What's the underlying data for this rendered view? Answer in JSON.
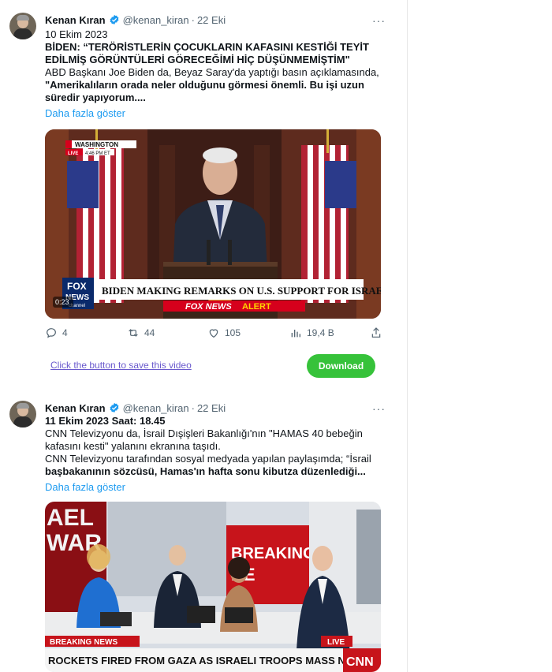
{
  "tweets": [
    {
      "author_name": "Kenan Kıran",
      "handle": "@kenan_kiran",
      "separator": "·",
      "date": "22 Eki",
      "more_label": "···",
      "lines": [
        "10 Ekim 2023",
        "BİDEN: “TERÖRİSTLERİN ÇOCUKLARIN KAFASINI KESTİĞİ TEYİT",
        "EDİLMİŞ GÖRÜNTÜLERİ GÖRECEĞİMİ HİÇ DÜŞÜNMEMİŞTİM\"",
        "ABD Başkanı Joe Biden da, Beyaz Saray'da yaptığı basın açıklamasında,",
        "\"Amerikalıların orada neler olduğunu görmesi önemli. Bu işi uzun",
        "süredir yapıyorum...."
      ],
      "show_more": "Daha fazla göster",
      "video": {
        "location": "WASHINGTON",
        "live": "LIVE",
        "time": "4:46 PM ET",
        "headline": "BIDEN MAKING REMARKS ON U.S. SUPPORT FOR ISRAEL",
        "logo_top": "FOX",
        "logo_bottom": "NEWS",
        "logo_sub": "channel",
        "alert_brand": "FOX NEWS",
        "alert_word": "ALERT",
        "timestamp": "0:23"
      },
      "stats": {
        "replies": "4",
        "retweets": "44",
        "likes": "105",
        "views": "19,4 B"
      }
    },
    {
      "author_name": "Kenan Kıran",
      "handle": "@kenan_kiran",
      "separator": "·",
      "date": "22 Eki",
      "more_label": "···",
      "lines": [
        "11 Ekim 2023 Saat: 18.45",
        "CNN Televizyonu da, İsrail Dışişleri Bakanlığı'nın \"HAMAS 40 bebeğin",
        "kafasını kesti\" yalanını ekranına taşıdı.",
        "CNN Televizyonu tarafından sosyal medyada yapılan paylaşımda; “İsrail",
        "başbakanının sözcüsü, Hamas'ın hafta sonu kibutza düzenlediği..."
      ],
      "show_more": "Daha fazla göster",
      "video": {
        "breaking": "BREAKING NEWS",
        "live": "LIVE",
        "headline": "ROCKETS FIRED FROM GAZA AS ISRAELI TROOPS MASS NEAR BORDER",
        "logo": "CNN",
        "wall_top": "BREAKING",
        "wall_bottom": "NE",
        "wall_left_top": "AEL",
        "wall_left_bottom": "WAR"
      }
    }
  ],
  "save_bar": {
    "link_text": "Click the button to save this video",
    "button_label": "Download"
  },
  "colors": {
    "accent_blue": "#1d9bf0",
    "download_green": "#36c23a",
    "fox_red": "#d6001c",
    "cnn_red": "#cc0000"
  }
}
